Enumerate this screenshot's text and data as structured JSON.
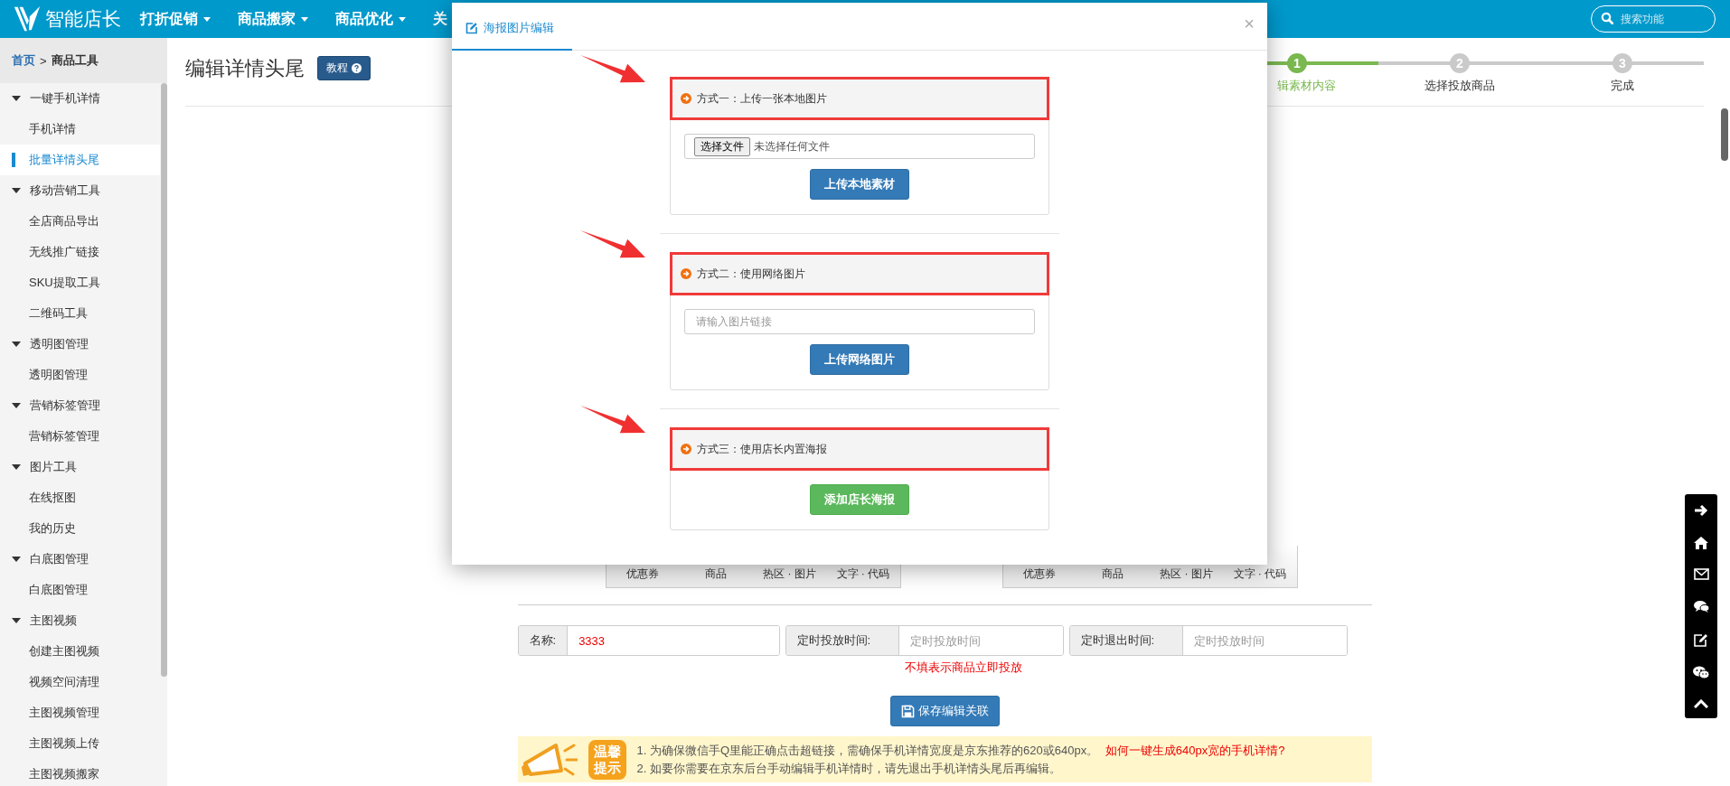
{
  "brand": {
    "name": "智能店长"
  },
  "nav": [
    {
      "label": "打折促销",
      "dropdown": true
    },
    {
      "label": "商品搬家",
      "dropdown": true
    },
    {
      "label": "商品优化",
      "dropdown": true
    },
    {
      "label": "关"
    }
  ],
  "search": {
    "placeholder": "搜索功能"
  },
  "breadcrumb": {
    "home": "首页",
    "separator": ">",
    "current": "商品工具"
  },
  "sidebar": {
    "groups": [
      {
        "label": "一键手机详情",
        "expanded": true,
        "children": [
          {
            "label": "手机详情",
            "selected": false
          },
          {
            "label": "批量详情头尾",
            "selected": true
          }
        ]
      },
      {
        "label": "移动营销工具",
        "expanded": true,
        "children": [
          {
            "label": "全店商品导出",
            "selected": false
          },
          {
            "label": "无线推广链接",
            "selected": false
          },
          {
            "label": "SKU提取工具",
            "selected": false
          },
          {
            "label": "二维码工具",
            "selected": false
          }
        ]
      },
      {
        "label": "透明图管理",
        "expanded": true,
        "children": [
          {
            "label": "透明图管理",
            "selected": false
          }
        ]
      },
      {
        "label": "营销标签管理",
        "expanded": true,
        "children": [
          {
            "label": "营销标签管理",
            "selected": false
          }
        ]
      },
      {
        "label": "图片工具",
        "expanded": true,
        "children": [
          {
            "label": "在线抠图",
            "selected": false
          },
          {
            "label": "我的历史",
            "selected": false
          }
        ]
      },
      {
        "label": "白底图管理",
        "expanded": true,
        "children": [
          {
            "label": "白底图管理",
            "selected": false
          }
        ]
      },
      {
        "label": "主图视频",
        "expanded": true,
        "children": [
          {
            "label": "创建主图视频",
            "selected": false
          },
          {
            "label": "视频空间清理",
            "selected": false
          },
          {
            "label": "主图视频管理",
            "selected": false
          },
          {
            "label": "主图视频上传",
            "selected": false
          },
          {
            "label": "主图视频搬家",
            "selected": false
          }
        ]
      }
    ]
  },
  "page": {
    "title": "编辑详情头尾",
    "help_button": "教程"
  },
  "steps": [
    {
      "number": "1",
      "label": "辑素材内容",
      "active": true
    },
    {
      "number": "2",
      "label": "选择投放商品",
      "active": false
    },
    {
      "number": "3",
      "label": "完成",
      "active": false
    }
  ],
  "toolbars": [
    {
      "items": [
        "优惠券",
        "商品",
        "热区 · 图片",
        "文字 · 代码"
      ]
    },
    {
      "items": [
        "优惠券",
        "商品",
        "热区 · 图片",
        "文字 · 代码"
      ]
    }
  ],
  "form": {
    "name_label": "名称:",
    "name_value": "3333",
    "start_label": "定时投放时间:",
    "start_placeholder": "定时投放时间",
    "end_label": "定时退出时间:",
    "end_placeholder": "定时投放时间",
    "hint": "不填表示商品立即投放",
    "save_button": "保存编辑关联"
  },
  "tip": {
    "badge": [
      "温馨",
      "提示"
    ],
    "lines": [
      {
        "text": "1. 为确保微信手Q里能正确点击超链接，需确保手机详情宽度是京东推荐的620或640px。",
        "link": "如何一键生成640px宽的手机详情?"
      },
      {
        "text": "2. 如要你需要在京东后台手动编辑手机详情时，请先退出手机详情头尾后再编辑。"
      }
    ]
  },
  "modal": {
    "tab": "海报图片编辑",
    "close": "×",
    "sections": [
      {
        "kind": "file",
        "title": "方式一：上传一张本地图片",
        "file_button": "选择文件",
        "file_status": "未选择任何文件",
        "button": "上传本地素材"
      },
      {
        "kind": "url",
        "title": "方式二：使用网络图片",
        "placeholder": "请输入图片链接",
        "button": "上传网络图片"
      },
      {
        "kind": "builtin",
        "title": "方式三：使用店长内置海报",
        "button": "添加店长海报"
      }
    ]
  }
}
